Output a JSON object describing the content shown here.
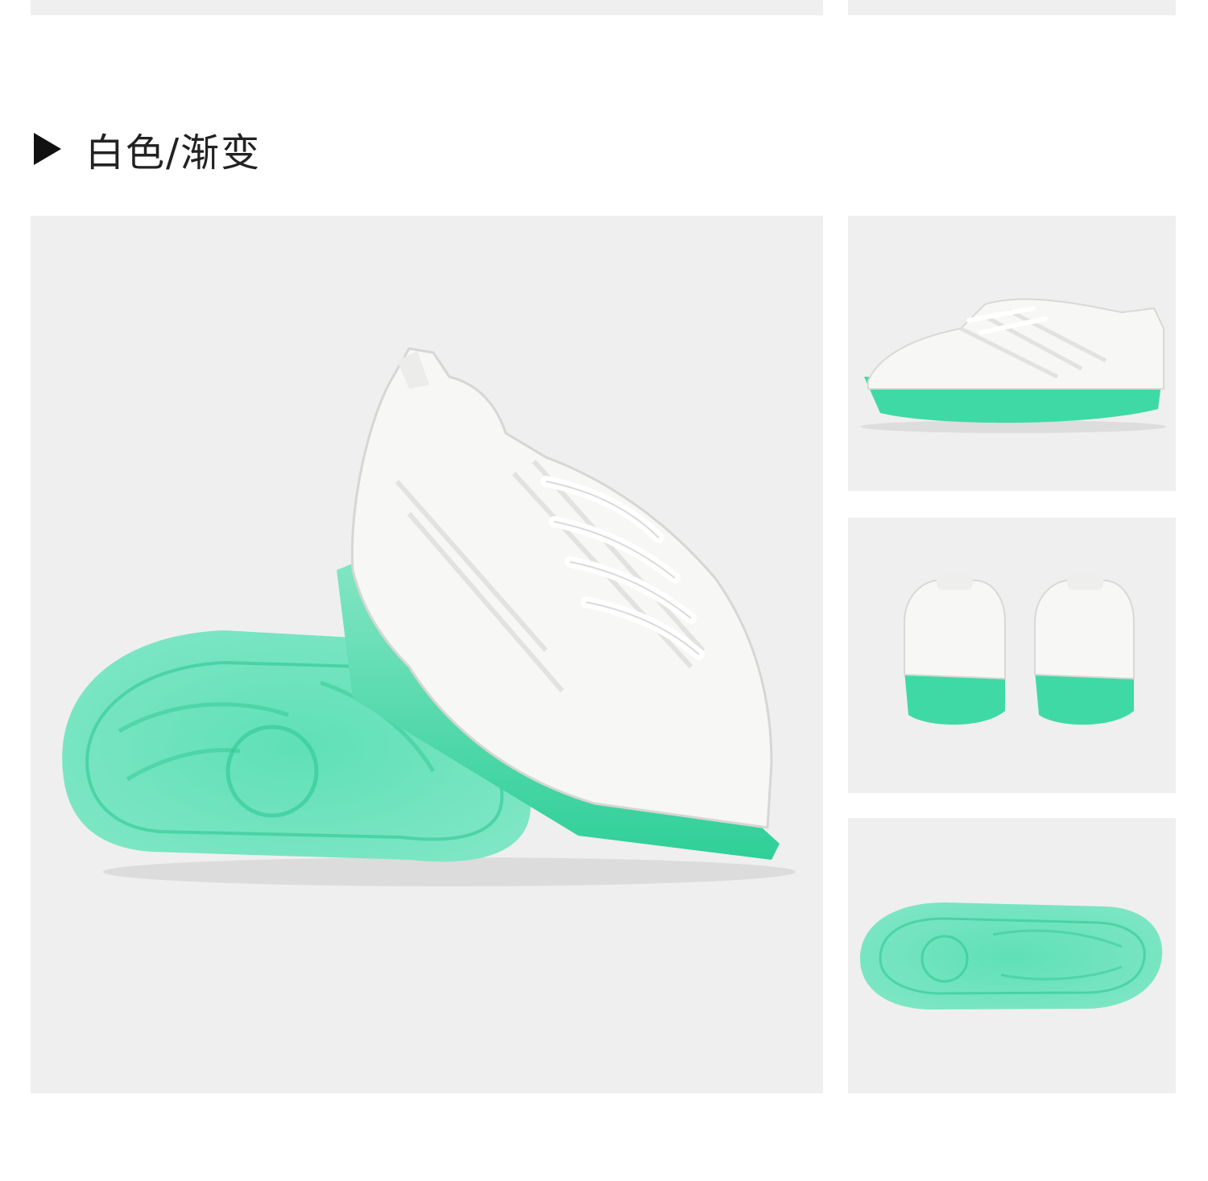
{
  "section": {
    "heading": "白色/渐变",
    "marker_icon": "play-triangle-icon"
  },
  "colors": {
    "panel_bg": "#efefef",
    "sole_green": "#3fd9a6",
    "upper_white": "#f7f7f5",
    "heading_text": "#222222"
  }
}
